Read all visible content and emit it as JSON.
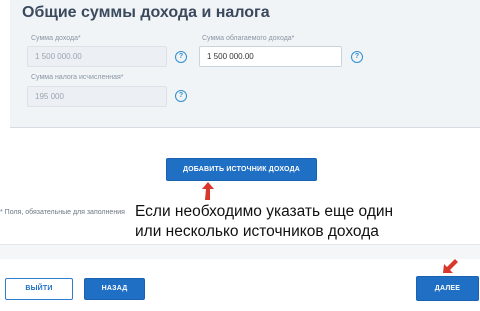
{
  "section": {
    "title": "Общие суммы дохода и налога"
  },
  "fields": {
    "income": {
      "label": "Сумма дохода*",
      "value": "1 500 000.00"
    },
    "taxable": {
      "label": "Сумма облагаемого дохода*",
      "value": "1 500 000.00"
    },
    "tax": {
      "label": "Сумма налога исчисленная*",
      "value": "195 000"
    },
    "help_symbol": "?"
  },
  "buttons": {
    "add_source": "ДОБАВИТЬ ИСТОЧНИК ДОХОДА",
    "exit": "ВЫЙТИ",
    "back": "НАЗАД",
    "next": "ДАЛЕЕ"
  },
  "notes": {
    "required": "* Поля, обязательные для заполнения"
  },
  "annotation": {
    "line1": "Если необходимо указать еще один",
    "line2": "или несколько источников дохода",
    "arrow_color": "#d9372b"
  },
  "colors": {
    "primary": "#1f6fc5",
    "panel_bg": "#f1f4f7"
  }
}
